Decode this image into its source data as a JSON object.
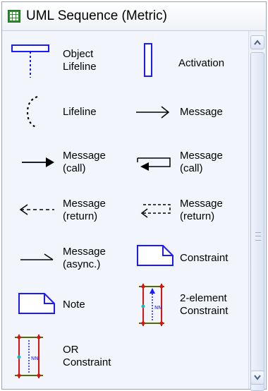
{
  "window": {
    "title": "UML Sequence (Metric)",
    "title_icon": "stencil-grid-icon"
  },
  "shapes": [
    {
      "name": "object-lifeline",
      "label": "Object\nLifeline",
      "icon": "object-lifeline-icon"
    },
    {
      "name": "activation",
      "label": "Activation",
      "icon": "activation-icon"
    },
    {
      "name": "lifeline",
      "label": "Lifeline",
      "icon": "lifeline-icon"
    },
    {
      "name": "message",
      "label": "Message",
      "icon": "message-arrow-icon"
    },
    {
      "name": "message-call",
      "label": "Message\n(call)",
      "icon": "message-call-arrow-icon"
    },
    {
      "name": "message-call-self",
      "label": "Message\n(call)",
      "icon": "message-call-self-arrow-icon"
    },
    {
      "name": "message-return",
      "label": "Message\n(return)",
      "icon": "message-return-arrow-icon"
    },
    {
      "name": "message-return-self",
      "label": "Message\n(return)",
      "icon": "message-return-self-arrow-icon"
    },
    {
      "name": "message-async",
      "label": "Message\n(async.)",
      "icon": "message-async-arrow-icon"
    },
    {
      "name": "constraint",
      "label": "Constraint",
      "icon": "constraint-note-icon"
    },
    {
      "name": "note",
      "label": "Note",
      "icon": "note-icon"
    },
    {
      "name": "two-element-constraint",
      "label": "2-element\nConstraint",
      "icon": "two-element-constraint-icon"
    },
    {
      "name": "or-constraint",
      "label": "OR\nConstraint",
      "icon": "or-constraint-icon"
    }
  ],
  "scrollbar": {
    "up_icon": "scroll-up-icon",
    "down_icon": "scroll-down-icon"
  }
}
